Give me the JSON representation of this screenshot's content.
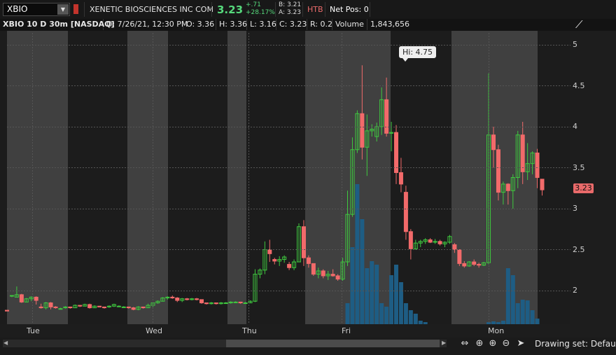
{
  "header": {
    "symbol": "XBIO",
    "company": "XENETIC BIOSCIENCES INC COM",
    "last": "3.23",
    "change": "+.71",
    "change_pct": "+28.17%",
    "bid": "B: 3.21",
    "ask": "A: 3.23",
    "htb": "HTB",
    "net_pos": "Net Pos: 0"
  },
  "info_bar": {
    "title": "XBIO 10 D 30m [NASDAQ]",
    "date": "D: 7/26/21, 12:30 PM",
    "open": "O: 3.36",
    "high": "H: 3.36",
    "low": "L: 3.16",
    "close": "C: 3.23",
    "range": "R: 0.2",
    "volume_label": "Volume",
    "volume_value": "1,843,656"
  },
  "hi_label": "Hi: 4.75",
  "price_label": "3.23",
  "drawing_set": "Drawing set: Default",
  "colors": {
    "up": "#3fc93f",
    "down": "#f26a6a",
    "volume": "#1e5d84"
  },
  "chart_data": {
    "type": "candlestick",
    "interval": "30m",
    "span": "10 D",
    "y_ticks": [
      2,
      2.5,
      3,
      3.5,
      4,
      4.5,
      5
    ],
    "ylim": [
      1.6,
      5.1
    ],
    "day_labels": [
      "Tue",
      "Wed",
      "Thu",
      "Fri",
      "Mon"
    ],
    "hi_marker": 4.75,
    "last_price": 3.23,
    "candles": [
      [
        1.76,
        1.76,
        1.75,
        1.75
      ],
      [
        1.94,
        1.94,
        1.92,
        1.94
      ],
      [
        1.92,
        2.05,
        1.92,
        1.95
      ],
      [
        1.95,
        1.96,
        1.85,
        1.86
      ],
      [
        1.86,
        1.91,
        1.86,
        1.9
      ],
      [
        1.9,
        1.93,
        1.87,
        1.92
      ],
      [
        1.92,
        1.93,
        1.83,
        1.88
      ],
      [
        1.8,
        1.84,
        1.78,
        1.79
      ],
      [
        1.79,
        1.86,
        1.77,
        1.85
      ],
      [
        1.85,
        1.86,
        1.77,
        1.8
      ],
      [
        1.8,
        1.81,
        1.78,
        1.79
      ],
      [
        1.78,
        1.79,
        1.77,
        1.78
      ],
      [
        1.79,
        1.81,
        1.78,
        1.8
      ],
      [
        1.8,
        1.8,
        1.78,
        1.79
      ],
      [
        1.79,
        1.83,
        1.79,
        1.82
      ],
      [
        1.82,
        1.82,
        1.8,
        1.81
      ],
      [
        1.81,
        1.84,
        1.81,
        1.83
      ],
      [
        1.83,
        1.84,
        1.78,
        1.79
      ],
      [
        1.79,
        1.82,
        1.79,
        1.81
      ],
      [
        1.81,
        1.81,
        1.8,
        1.8
      ],
      [
        1.8,
        1.8,
        1.78,
        1.79
      ],
      [
        1.8,
        1.82,
        1.79,
        1.81
      ],
      [
        1.81,
        1.84,
        1.8,
        1.83
      ],
      [
        1.81,
        1.82,
        1.8,
        1.81
      ],
      [
        1.8,
        1.81,
        1.79,
        1.8
      ],
      [
        1.8,
        1.8,
        1.78,
        1.79
      ],
      [
        1.79,
        1.8,
        1.76,
        1.77
      ],
      [
        1.77,
        1.81,
        1.76,
        1.8
      ],
      [
        1.8,
        1.8,
        1.78,
        1.79
      ],
      [
        1.79,
        1.84,
        1.79,
        1.82
      ],
      [
        1.82,
        1.86,
        1.8,
        1.85
      ],
      [
        1.85,
        1.88,
        1.84,
        1.87
      ],
      [
        1.87,
        1.92,
        1.87,
        1.91
      ],
      [
        1.91,
        1.93,
        1.89,
        1.92
      ],
      [
        1.92,
        1.94,
        1.9,
        1.91
      ],
      [
        1.91,
        1.92,
        1.86,
        1.88
      ],
      [
        1.88,
        1.91,
        1.86,
        1.9
      ],
      [
        1.9,
        1.91,
        1.88,
        1.89
      ],
      [
        1.89,
        1.91,
        1.88,
        1.9
      ],
      [
        1.9,
        1.91,
        1.88,
        1.89
      ],
      [
        1.89,
        1.89,
        1.84,
        1.85
      ],
      [
        1.85,
        1.85,
        1.83,
        1.84
      ],
      [
        1.84,
        1.86,
        1.83,
        1.85
      ],
      [
        1.85,
        1.85,
        1.83,
        1.84
      ],
      [
        1.84,
        1.86,
        1.83,
        1.85
      ],
      [
        1.85,
        1.86,
        1.84,
        1.85
      ],
      [
        1.85,
        1.87,
        1.84,
        1.86
      ],
      [
        1.86,
        1.87,
        1.85,
        1.86
      ],
      [
        1.86,
        1.86,
        1.84,
        1.85
      ],
      [
        1.85,
        1.86,
        1.84,
        1.85
      ],
      [
        1.85,
        1.88,
        1.85,
        1.87
      ],
      [
        1.87,
        2.26,
        1.86,
        2.2
      ],
      [
        2.2,
        2.27,
        2.15,
        2.25
      ],
      [
        2.25,
        2.6,
        2.2,
        2.5
      ],
      [
        2.5,
        2.62,
        2.35,
        2.45
      ],
      [
        2.38,
        2.4,
        2.32,
        2.36
      ],
      [
        2.36,
        2.42,
        2.3,
        2.38
      ],
      [
        2.38,
        2.43,
        2.34,
        2.41
      ],
      [
        2.32,
        2.35,
        2.25,
        2.28
      ],
      [
        2.28,
        2.38,
        2.25,
        2.35
      ],
      [
        2.35,
        2.82,
        2.35,
        2.78
      ],
      [
        2.78,
        2.86,
        2.3,
        2.4
      ],
      [
        2.4,
        2.43,
        2.28,
        2.33
      ],
      [
        2.33,
        2.33,
        2.18,
        2.2
      ],
      [
        2.2,
        2.28,
        2.15,
        2.24
      ],
      [
        2.24,
        2.26,
        2.15,
        2.18
      ],
      [
        2.18,
        2.24,
        2.13,
        2.2
      ],
      [
        2.2,
        2.26,
        2.17,
        2.18
      ],
      [
        2.18,
        2.2,
        2.12,
        2.14
      ],
      [
        2.14,
        2.4,
        2.12,
        2.35
      ],
      [
        2.35,
        3.22,
        2.3,
        2.93
      ],
      [
        2.93,
        3.87,
        2.9,
        3.72
      ],
      [
        3.72,
        4.2,
        3.68,
        4.16
      ],
      [
        4.16,
        4.75,
        3.6,
        3.75
      ],
      [
        3.75,
        4.15,
        3.4,
        3.95
      ],
      [
        3.95,
        4.03,
        3.88,
        3.97
      ],
      [
        3.88,
        4.05,
        3.82,
        4
      ],
      [
        4,
        4.48,
        3.9,
        4.33
      ],
      [
        4.33,
        4.6,
        3.88,
        3.92
      ],
      [
        3.92,
        4.06,
        3.7,
        3.93
      ],
      [
        3.93,
        4.02,
        3.3,
        3.44
      ],
      [
        3.44,
        3.62,
        3.2,
        3.3
      ],
      [
        3.2,
        3.28,
        2.62,
        2.72
      ],
      [
        2.72,
        2.75,
        2.38,
        2.51
      ],
      [
        2.51,
        2.62,
        2.5,
        2.58
      ],
      [
        2.58,
        2.62,
        2.53,
        2.6
      ],
      [
        2.6,
        2.64,
        2.57,
        2.62
      ],
      [
        2.62,
        2.64,
        2.58,
        2.59
      ],
      [
        2.59,
        2.63,
        2.57,
        2.6
      ],
      [
        2.6,
        2.62,
        2.55,
        2.57
      ],
      [
        2.57,
        2.6,
        2.53,
        2.59
      ],
      [
        2.59,
        2.68,
        2.57,
        2.66
      ],
      [
        2.56,
        2.58,
        2.46,
        2.5
      ],
      [
        2.5,
        2.5,
        2.3,
        2.33
      ],
      [
        2.33,
        2.36,
        2.28,
        2.3
      ],
      [
        2.3,
        2.36,
        2.29,
        2.35
      ],
      [
        2.35,
        2.38,
        2.3,
        2.32
      ],
      [
        2.32,
        2.34,
        2.28,
        2.31
      ],
      [
        2.31,
        2.35,
        2.3,
        2.34
      ],
      [
        2.34,
        4.65,
        2.32,
        3.9
      ],
      [
        3.9,
        4,
        3.5,
        3.72
      ],
      [
        3.72,
        3.78,
        3.1,
        3.2
      ],
      [
        3.2,
        3.33,
        3.05,
        3.3
      ],
      [
        3.3,
        3.31,
        3.05,
        3.22
      ],
      [
        3.22,
        3.42,
        3,
        3.38
      ],
      [
        3.38,
        3.95,
        3.25,
        3.9
      ],
      [
        3.9,
        4.06,
        3.3,
        3.45
      ],
      [
        3.45,
        3.8,
        3.35,
        3.55
      ],
      [
        3.55,
        3.7,
        3.42,
        3.68
      ],
      [
        3.68,
        3.73,
        3.25,
        3.38
      ],
      [
        3.36,
        3.36,
        3.16,
        3.23
      ]
    ]
  }
}
